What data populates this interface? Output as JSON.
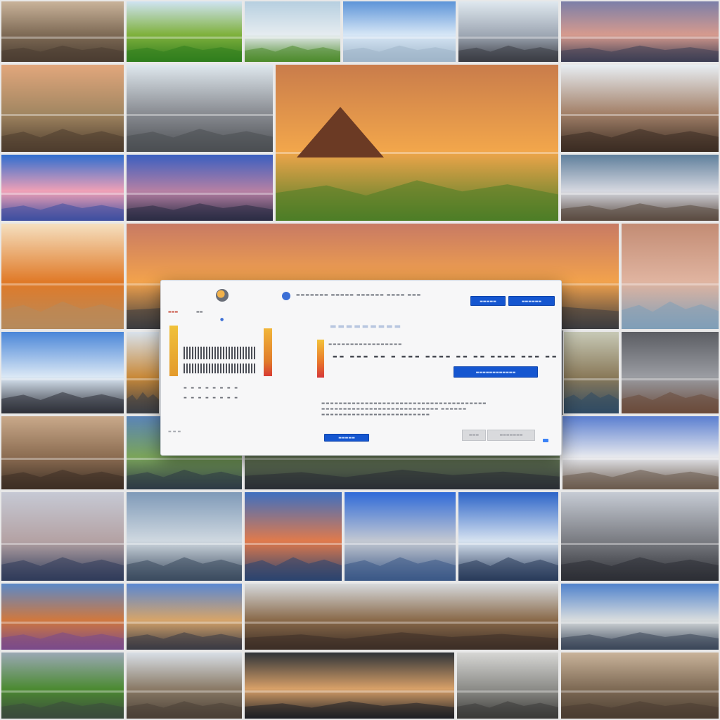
{
  "background": {
    "tiles": [
      {
        "name": "tile-cathedral",
        "c": [
          "#c9b39a",
          "#7e6a55",
          "#4a3d31"
        ]
      },
      {
        "name": "tile-green-hill",
        "c": [
          "#cfe3f2",
          "#7fb13c",
          "#2f7d1e"
        ]
      },
      {
        "name": "tile-snowy-rocks",
        "c": [
          "#b6cfe0",
          "#e6ecf0",
          "#4d8a2b"
        ]
      },
      {
        "name": "tile-sky-clouds",
        "c": [
          "#5d94d8",
          "#d6e6f6",
          "#9fb5c8"
        ]
      },
      {
        "name": "tile-airship",
        "c": [
          "#dfe8ef",
          "#9fa8b4",
          "#3a3c44"
        ]
      },
      {
        "name": "tile-pink-dusk",
        "c": [
          "#7b7fa8",
          "#d69a8e",
          "#3c3e53"
        ]
      },
      {
        "name": "tile-temple-dusk",
        "c": [
          "#e2a77c",
          "#a38762",
          "#4d3c2d"
        ]
      },
      {
        "name": "tile-thatched-hut",
        "c": [
          "#dfe8ee",
          "#8a8d93",
          "#4b4e52"
        ]
      },
      {
        "name": "tile-hero-sunset-peak",
        "c": [
          "#c97c4b",
          "#f2a64b",
          "#4c7d27"
        ]
      },
      {
        "name": "tile-pavilion",
        "c": [
          "#e8eef3",
          "#a4826a",
          "#3b2c22"
        ]
      },
      {
        "name": "tile-mountain-dawn",
        "c": [
          "#2f6ed0",
          "#f0a0b6",
          "#3e4fa0"
        ]
      },
      {
        "name": "tile-spires-dusk",
        "c": [
          "#3b5fc0",
          "#b680a4",
          "#2a2c44"
        ]
      },
      {
        "name": "tile-pink-tree",
        "c": [
          "#5f7f9c",
          "#d6d8e0",
          "#5a4a40"
        ]
      },
      {
        "name": "tile-sun-dunes",
        "c": [
          "#f5e0c0",
          "#e07a28",
          "#b68a5c"
        ]
      },
      {
        "name": "tile-panoramic-sunset",
        "c": [
          "#c87a64",
          "#f2a24c",
          "#3c3d40"
        ]
      },
      {
        "name": "tile-misty-lake",
        "c": [
          "#c38c74",
          "#e0b4a0",
          "#7f9fb8"
        ]
      },
      {
        "name": "tile-train-station",
        "c": [
          "#4a86d8",
          "#dbe8f5",
          "#2e3038"
        ]
      },
      {
        "name": "tile-towers",
        "c": [
          "#d8e2ec",
          "#c98a3a",
          "#3b3e46"
        ]
      },
      {
        "name": "tile-old-mill",
        "c": [
          "#c7c9b6",
          "#8a7a5a",
          "#2f4a63"
        ]
      },
      {
        "name": "tile-storm-clouds",
        "c": [
          "#5b5d62",
          "#9a9ca2",
          "#6a4a3a"
        ]
      },
      {
        "name": "tile-arcade",
        "c": [
          "#c9a98a",
          "#8c6d52",
          "#3c2e24"
        ]
      },
      {
        "name": "tile-fountain",
        "c": [
          "#5a84b8",
          "#7aa45a",
          "#2e3a46"
        ]
      },
      {
        "name": "tile-street",
        "c": [
          "#aab8c4",
          "#6a7e5a",
          "#2a2e34"
        ]
      },
      {
        "name": "tile-gothic-abbey",
        "c": [
          "#5a7ed0",
          "#e6e8ee",
          "#6a5a4c"
        ]
      },
      {
        "name": "tile-church-lake",
        "c": [
          "#c6c9d4",
          "#b4a2a4",
          "#2f3b5a"
        ]
      },
      {
        "name": "tile-misty-shore",
        "c": [
          "#7f9ab8",
          "#cfd8e0",
          "#3a4a5e"
        ]
      },
      {
        "name": "tile-lighthouse-bay",
        "c": [
          "#3e6fc0",
          "#e07a4c",
          "#2a4470"
        ]
      },
      {
        "name": "tile-ruin-water",
        "c": [
          "#2f6ad8",
          "#c3c8d2",
          "#3a5886"
        ]
      },
      {
        "name": "tile-harbor",
        "c": [
          "#2c64c8",
          "#d6e2f0",
          "#283a5a"
        ]
      },
      {
        "name": "tile-palace",
        "c": [
          "#c6cbd4",
          "#7a7c82",
          "#2c2e34"
        ]
      },
      {
        "name": "tile-autumn-park",
        "c": [
          "#5b89c8",
          "#d0783e",
          "#7a4a8a"
        ]
      },
      {
        "name": "tile-manor-autumn",
        "c": [
          "#5a88d2",
          "#d6a46a",
          "#3a3a44"
        ]
      },
      {
        "name": "tile-factory",
        "c": [
          "#d6d9dc",
          "#8a6a4a",
          "#3c2e26"
        ]
      },
      {
        "name": "tile-baroque-church",
        "c": [
          "#4f82cc",
          "#d8dcde",
          "#3a4658"
        ]
      },
      {
        "name": "tile-green-valley",
        "c": [
          "#9aa8b4",
          "#4c8a32",
          "#3a4a3c"
        ]
      },
      {
        "name": "tile-hillside-village",
        "c": [
          "#d8dfe6",
          "#8a7a66",
          "#4a4036"
        ]
      },
      {
        "name": "tile-dark-dunes",
        "c": [
          "#2e3338",
          "#d8a068",
          "#1e1f24"
        ]
      },
      {
        "name": "tile-sepia-warehouse",
        "c": [
          "#d6d6d4",
          "#8c8c88",
          "#3b3a38"
        ]
      }
    ]
  },
  "dialog": {
    "toolbar_text": "▬▬▬▬▬▬▬  ▬▬▬▬▬  ▬▬▬▬▬▬  ▬▬▬▬  ▬▬▬",
    "primary_button_1": "▬▬▬▬▬",
    "primary_button_2": "▬▬▬▬▬▬",
    "side_tab_label": "▬▬▬",
    "side_tab_label_2": "▬▬",
    "heading": "▬▬▬▬▬▬▬▬▬",
    "subheading": "▬▬▬▬▬▬▬▬▬▬▬▬▬▬▬▬▬",
    "row_text": "▬▬  ▬▬▬  ▬▬  ▬  ▬▬▬  ▬▬▬▬  ▬▬  ▬▬  ▬▬▬▬  ▬▬▬  ▬▬",
    "action_button": "▬▬▬▬▬▬▬▬▬▬▬▬",
    "body_line_1": "▬▬▬▬▬▬▬▬▬▬▬▬▬▬▬▬▬▬▬▬▬▬▬▬▬▬▬▬▬▬▬▬▬▬▬▬▬▬",
    "body_line_2": "▬▬▬▬▬▬▬▬▬▬▬▬▬▬▬▬▬▬▬▬▬▬▬▬▬▬▬  ▬▬▬▬▬▬",
    "body_line_3": "▬▬▬▬▬▬▬▬▬▬▬▬▬▬▬▬▬▬▬▬▬▬▬▬▬",
    "list_row_1": "▬  ▬  ▬  ▬  ▬  ▬  ▬  ▬",
    "list_row_2": "▬  ▬  ▬  ▬  ▬  ▬  ▬  ▬",
    "left_footer": "▬▬▬",
    "bottom_button": "▬▬▬▬▬",
    "cancel_button": "▬▬▬",
    "ok_button": "▬▬▬▬▬▬▬"
  }
}
